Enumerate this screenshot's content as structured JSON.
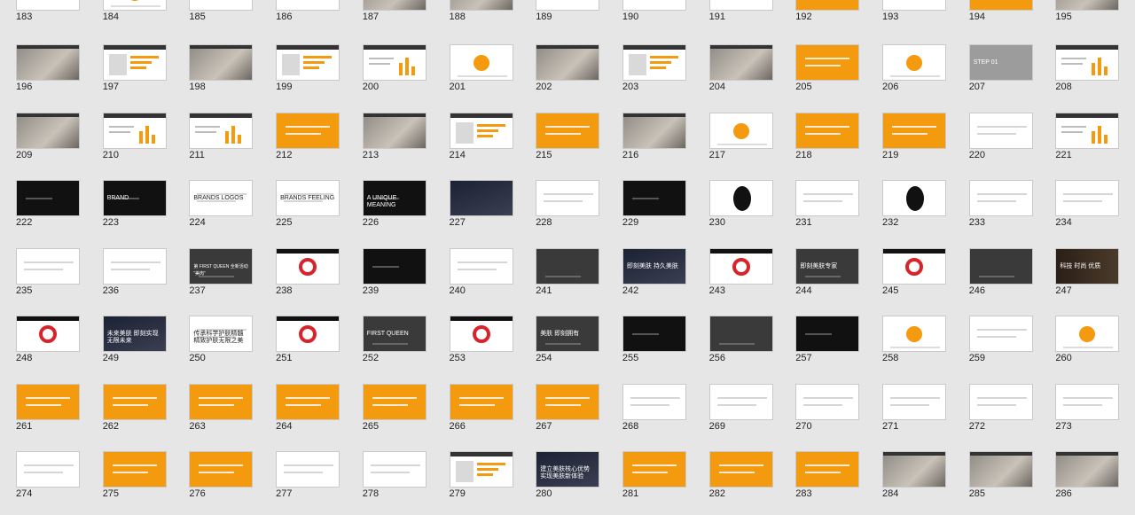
{
  "slides": [
    {
      "num": "183",
      "style": "white"
    },
    {
      "num": "184",
      "style": "orange-circle"
    },
    {
      "num": "185",
      "style": "white"
    },
    {
      "num": "186",
      "style": "white"
    },
    {
      "num": "187",
      "style": "photo"
    },
    {
      "num": "188",
      "style": "photo"
    },
    {
      "num": "189",
      "style": "white"
    },
    {
      "num": "190",
      "style": "white"
    },
    {
      "num": "191",
      "style": "white"
    },
    {
      "num": "192",
      "style": "orange"
    },
    {
      "num": "193",
      "style": "white"
    },
    {
      "num": "194",
      "style": "orange"
    },
    {
      "num": "195",
      "style": "photo"
    },
    {
      "num": "196",
      "style": "photo"
    },
    {
      "num": "197",
      "style": "white-bars"
    },
    {
      "num": "198",
      "style": "photo"
    },
    {
      "num": "199",
      "style": "white-bars"
    },
    {
      "num": "200",
      "style": "white-chart"
    },
    {
      "num": "201",
      "style": "orange-circle"
    },
    {
      "num": "202",
      "style": "photo"
    },
    {
      "num": "203",
      "style": "white-bars"
    },
    {
      "num": "204",
      "style": "photo"
    },
    {
      "num": "205",
      "style": "orange"
    },
    {
      "num": "206",
      "style": "orange-circle"
    },
    {
      "num": "207",
      "style": "gray",
      "text": "STEP 01"
    },
    {
      "num": "208",
      "style": "white-chart"
    },
    {
      "num": "209",
      "style": "photo"
    },
    {
      "num": "210",
      "style": "white-chart"
    },
    {
      "num": "211",
      "style": "white-chart"
    },
    {
      "num": "212",
      "style": "orange"
    },
    {
      "num": "213",
      "style": "photo"
    },
    {
      "num": "214",
      "style": "white-bars"
    },
    {
      "num": "215",
      "style": "orange"
    },
    {
      "num": "216",
      "style": "photo"
    },
    {
      "num": "217",
      "style": "orange-circle"
    },
    {
      "num": "218",
      "style": "orange"
    },
    {
      "num": "219",
      "style": "orange"
    },
    {
      "num": "220",
      "style": "white"
    },
    {
      "num": "221",
      "style": "white-chart"
    },
    {
      "num": "222",
      "style": "black"
    },
    {
      "num": "223",
      "style": "black",
      "text": "BRAND"
    },
    {
      "num": "224",
      "style": "white",
      "text": "BRANDS   LOGOS"
    },
    {
      "num": "225",
      "style": "white",
      "text": "BRANDS   FEELING"
    },
    {
      "num": "226",
      "style": "black",
      "text": "A UNIQUE MEANING"
    },
    {
      "num": "227",
      "style": "night"
    },
    {
      "num": "228",
      "style": "white"
    },
    {
      "num": "229",
      "style": "black"
    },
    {
      "num": "230",
      "style": "head"
    },
    {
      "num": "231",
      "style": "white"
    },
    {
      "num": "232",
      "style": "head"
    },
    {
      "num": "233",
      "style": "white"
    },
    {
      "num": "234",
      "style": "white"
    },
    {
      "num": "235",
      "style": "white"
    },
    {
      "num": "236",
      "style": "white"
    },
    {
      "num": "237",
      "style": "dark",
      "text": "第 FIRST QUEEN 全新活动 “美肉”"
    },
    {
      "num": "238",
      "style": "white-red"
    },
    {
      "num": "239",
      "style": "black"
    },
    {
      "num": "240",
      "style": "white"
    },
    {
      "num": "241",
      "style": "dark"
    },
    {
      "num": "242",
      "style": "night",
      "text": "即刻美肤 持久美肤"
    },
    {
      "num": "243",
      "style": "white-red"
    },
    {
      "num": "244",
      "style": "dark",
      "text": "即刻美肤专家"
    },
    {
      "num": "245",
      "style": "white-red"
    },
    {
      "num": "246",
      "style": "dark"
    },
    {
      "num": "247",
      "style": "brown",
      "text": "科技 时尚 优质"
    },
    {
      "num": "248",
      "style": "white-red"
    },
    {
      "num": "249",
      "style": "night",
      "text": "未来美肤 即刻实现无限未来"
    },
    {
      "num": "250",
      "style": "white",
      "text": "传承科学护肤精髓 精致护肤无限之美"
    },
    {
      "num": "251",
      "style": "white-red"
    },
    {
      "num": "252",
      "style": "dark",
      "text": "FIRST QUEEN"
    },
    {
      "num": "253",
      "style": "white-red"
    },
    {
      "num": "254",
      "style": "dark",
      "text": "美肤 即刻拥有"
    },
    {
      "num": "255",
      "style": "black"
    },
    {
      "num": "256",
      "style": "dark"
    },
    {
      "num": "257",
      "style": "black"
    },
    {
      "num": "258",
      "style": "orange-circle"
    },
    {
      "num": "259",
      "style": "white"
    },
    {
      "num": "260",
      "style": "orange-circle"
    },
    {
      "num": "261",
      "style": "orange"
    },
    {
      "num": "262",
      "style": "orange"
    },
    {
      "num": "263",
      "style": "orange"
    },
    {
      "num": "264",
      "style": "orange"
    },
    {
      "num": "265",
      "style": "orange"
    },
    {
      "num": "266",
      "style": "orange"
    },
    {
      "num": "267",
      "style": "orange"
    },
    {
      "num": "268",
      "style": "white"
    },
    {
      "num": "269",
      "style": "white"
    },
    {
      "num": "270",
      "style": "white"
    },
    {
      "num": "271",
      "style": "white"
    },
    {
      "num": "272",
      "style": "white"
    },
    {
      "num": "273",
      "style": "white"
    },
    {
      "num": "274",
      "style": "white"
    },
    {
      "num": "275",
      "style": "orange"
    },
    {
      "num": "276",
      "style": "orange"
    },
    {
      "num": "277",
      "style": "white"
    },
    {
      "num": "278",
      "style": "white"
    },
    {
      "num": "279",
      "style": "white-bars"
    },
    {
      "num": "280",
      "style": "night",
      "text": "建立美肤核心优势 实现美肤新体验"
    },
    {
      "num": "281",
      "style": "orange"
    },
    {
      "num": "282",
      "style": "orange"
    },
    {
      "num": "283",
      "style": "orange"
    },
    {
      "num": "284",
      "style": "photo"
    },
    {
      "num": "285",
      "style": "photo"
    },
    {
      "num": "286",
      "style": "photo"
    }
  ],
  "colors": {
    "orange": "#f39a0f",
    "black": "#111111",
    "dark": "#3a3a3a",
    "gray": "#9c9c9c",
    "red": "#d8232a",
    "brown": "#4a3a2a"
  }
}
